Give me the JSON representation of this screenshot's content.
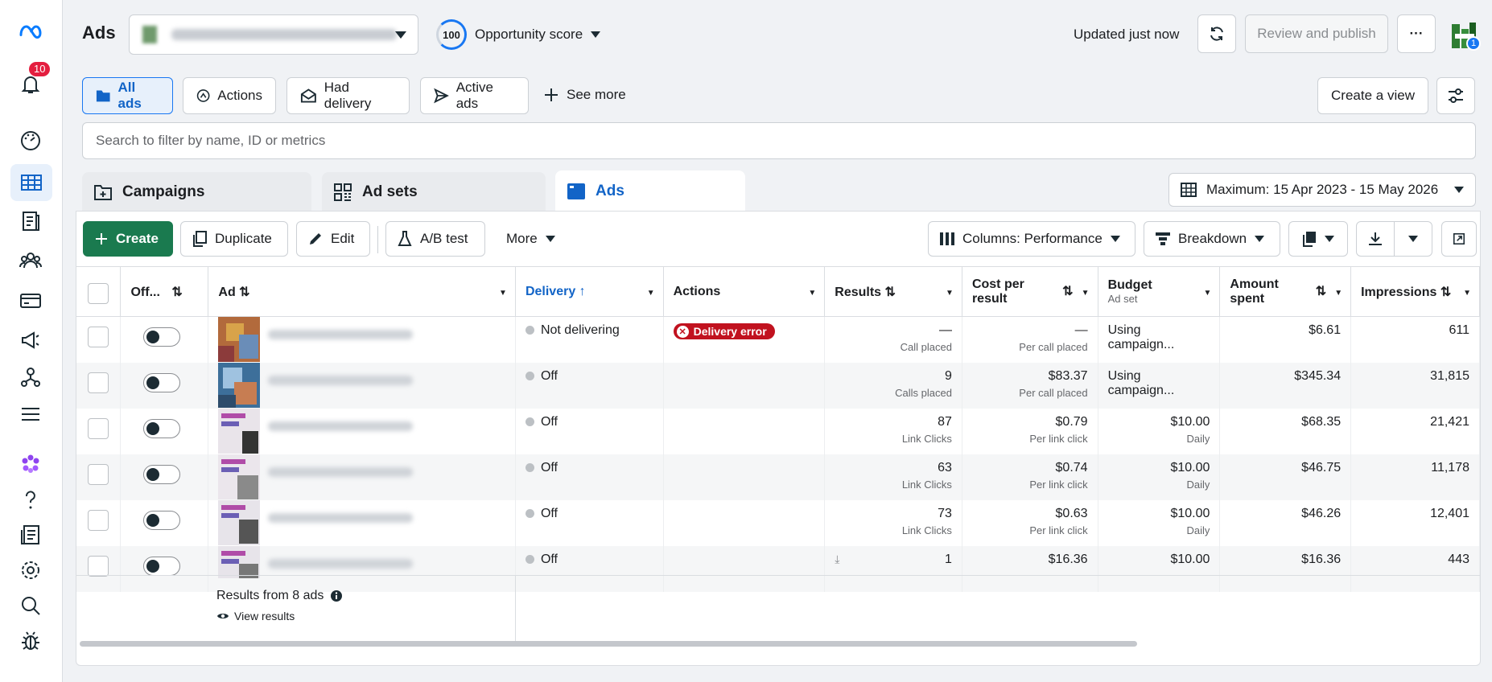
{
  "rail": {
    "notif_count": "10"
  },
  "header": {
    "title": "Ads",
    "opportunity_score": "100",
    "opportunity_label": "Opportunity score",
    "updated": "Updated just now",
    "review_publish": "Review and publish",
    "more": "···",
    "avatar_badge": "1"
  },
  "chips": {
    "all_ads": "All ads",
    "actions": "Actions",
    "had_delivery": "Had delivery",
    "active_ads": "Active ads",
    "see_more": "See more",
    "create_view": "Create a view"
  },
  "search": {
    "placeholder": "Search to filter by name, ID or metrics"
  },
  "levels": {
    "campaigns": "Campaigns",
    "ad_sets": "Ad sets",
    "ads": "Ads"
  },
  "date_range": "Maximum: 15 Apr 2023 - 15 May 2026",
  "toolbar": {
    "create": "Create",
    "duplicate": "Duplicate",
    "edit": "Edit",
    "ab_test": "A/B test",
    "more": "More",
    "columns": "Columns: Performance",
    "breakdown": "Breakdown"
  },
  "columns": {
    "off": "Off...",
    "ad": "Ad",
    "delivery": "Delivery",
    "actions": "Actions",
    "results": "Results",
    "cost_line1": "Cost per",
    "cost_line2": "result",
    "budget": "Budget",
    "budget_sub": "Ad set",
    "amount_line1": "Amount",
    "amount_line2": "spent",
    "impressions": "Impressions"
  },
  "rows": [
    {
      "delivery": "Not delivering",
      "action": "Delivery error",
      "results": "—",
      "results_sub": "Call placed",
      "cost": "—",
      "cost_sub": "Per call placed",
      "budget": "Using campaign...",
      "budget_sub": "",
      "spent": "$6.61",
      "impressions": "611"
    },
    {
      "delivery": "Off",
      "action": "",
      "results": "9",
      "results_sub": "Calls placed",
      "cost": "$83.37",
      "cost_sub": "Per call placed",
      "budget": "Using campaign...",
      "budget_sub": "",
      "spent": "$345.34",
      "impressions": "31,815"
    },
    {
      "delivery": "Off",
      "action": "",
      "results": "87",
      "results_sub": "Link Clicks",
      "cost": "$0.79",
      "cost_sub": "Per link click",
      "budget": "$10.00",
      "budget_sub": "Daily",
      "spent": "$68.35",
      "impressions": "21,421"
    },
    {
      "delivery": "Off",
      "action": "",
      "results": "63",
      "results_sub": "Link Clicks",
      "cost": "$0.74",
      "cost_sub": "Per link click",
      "budget": "$10.00",
      "budget_sub": "Daily",
      "spent": "$46.75",
      "impressions": "11,178"
    },
    {
      "delivery": "Off",
      "action": "",
      "results": "73",
      "results_sub": "Link Clicks",
      "cost": "$0.63",
      "cost_sub": "Per link click",
      "budget": "$10.00",
      "budget_sub": "Daily",
      "spent": "$46.26",
      "impressions": "12,401"
    },
    {
      "delivery": "Off",
      "action": "",
      "results": "1",
      "results_sub": "",
      "cost": "$16.36",
      "cost_sub": "",
      "budget": "$10.00",
      "budget_sub": "",
      "spent": "$16.36",
      "impressions": "443"
    }
  ],
  "footer": {
    "results_from": "Results from 8 ads",
    "view_results": "View results"
  },
  "colors": {
    "primary_green": "#1a7a4f",
    "accent_blue": "#1264c7",
    "error_red": "#c1121f"
  }
}
